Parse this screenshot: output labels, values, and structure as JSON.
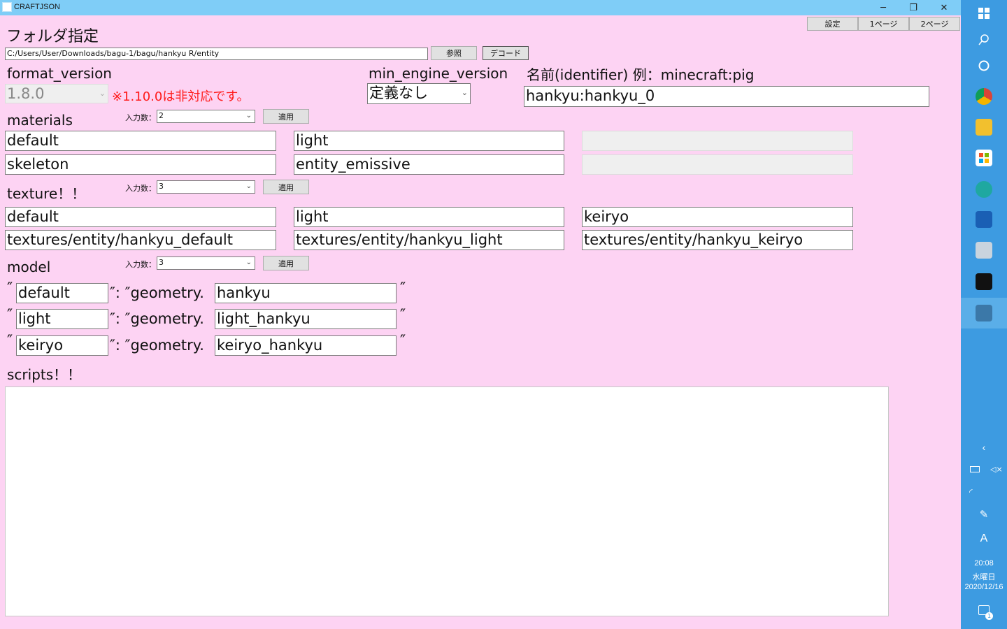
{
  "window": {
    "title": "CRAFTJSON",
    "minimize": "─",
    "restore": "❐",
    "close": "✕"
  },
  "header_buttons": {
    "settings": "設定",
    "page1": "1ページ",
    "page2": "2ページ"
  },
  "folder": {
    "heading": "フォルダ指定",
    "path": "C:/Users/User/Downloads/bagu-1/bagu/hankyu R/entity",
    "browse_label": "参照",
    "decode_label": "デコード"
  },
  "format_version": {
    "label": "format_version",
    "value": "1.8.0",
    "warning": "※1.10.0は非対応です。"
  },
  "min_engine_version": {
    "label": "min_engine_version",
    "value": "定義なし"
  },
  "identifier": {
    "label": "名前(identifier) 例：minecraft:pig",
    "value": "hankyu:hankyu_0"
  },
  "materials": {
    "label": "materials",
    "count_label": "入力数：",
    "count": "2",
    "apply_label": "適用",
    "keys": [
      "default",
      "light",
      ""
    ],
    "values": [
      "skeleton",
      "entity_emissive",
      ""
    ]
  },
  "texture": {
    "label": "texture！！",
    "count_label": "入力数：",
    "count": "3",
    "apply_label": "適用",
    "keys": [
      "default",
      "light",
      "keiryo"
    ],
    "values": [
      "textures/entity/hankyu_default",
      "textures/entity/hankyu_light",
      "textures/entity/hankyu_keiryo"
    ]
  },
  "model": {
    "label": "model",
    "count_label": "入力数：",
    "count": "3",
    "apply_label": "適用",
    "open_quote": "″",
    "separator": "″: ″geometry.",
    "close_quote": "″",
    "rows": [
      {
        "key": "default",
        "geometry": "hankyu"
      },
      {
        "key": "light",
        "geometry": "light_hankyu"
      },
      {
        "key": "keiryo",
        "geometry": "keiryo_hankyu"
      }
    ]
  },
  "scripts": {
    "label": "scripts！！",
    "content": ""
  },
  "taskbar": {
    "time": "20:08",
    "weekday": "水曜日",
    "date": "2020/12/16",
    "ime": "A",
    "notifications": "1"
  },
  "colors": {
    "background": "#fdd3f3",
    "titlebar": "#7fcdf7",
    "taskbar": "#3d9be1",
    "warning": "#ff1a1a"
  }
}
